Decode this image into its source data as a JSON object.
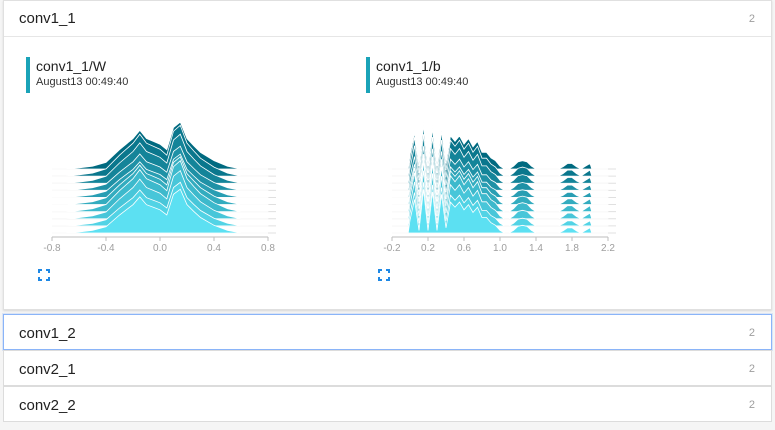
{
  "sections": [
    {
      "title": "conv1_1",
      "count": "2"
    },
    {
      "title": "conv1_2",
      "count": "2"
    },
    {
      "title": "conv2_1",
      "count": "2"
    },
    {
      "title": "conv2_2",
      "count": "2"
    }
  ],
  "cards": [
    {
      "title": "conv1_1/W",
      "subtitle": "August13 00:49:40",
      "fullscreen_icon": "fullscreen-icon"
    },
    {
      "title": "conv1_1/b",
      "subtitle": "August13 00:49:40",
      "fullscreen_icon": "fullscreen-icon"
    }
  ],
  "colors": {
    "accent": "#1aa3b8",
    "dark_teal": "#006a80",
    "light_cyan": "#5ce0f2",
    "selected_border": "#8ab4f8"
  },
  "chart_data": [
    {
      "type": "area",
      "x_ticks": [
        "-0.8",
        "-0.4",
        "0.0",
        "0.4",
        "0.8"
      ],
      "x_tick_values": [
        -0.8,
        -0.4,
        0.0,
        0.4,
        0.8
      ],
      "xlim": [
        -0.8,
        0.8
      ],
      "y_ticks": [
        "0",
        "40",
        "80"
      ],
      "y_tick_values": [
        0,
        40,
        80
      ],
      "steps": [
        0,
        10,
        20,
        30,
        40,
        50,
        60,
        70,
        80,
        90
      ],
      "x": [
        -0.8,
        -0.7,
        -0.6,
        -0.5,
        -0.4,
        -0.3,
        -0.2,
        -0.15,
        -0.1,
        -0.05,
        0.0,
        0.05,
        0.1,
        0.15,
        0.2,
        0.25,
        0.3,
        0.4,
        0.5,
        0.6,
        0.7,
        0.8
      ],
      "density": [
        0,
        0,
        0.02,
        0.05,
        0.12,
        0.35,
        0.55,
        0.7,
        0.55,
        0.5,
        0.45,
        0.35,
        0.75,
        0.85,
        0.55,
        0.42,
        0.3,
        0.15,
        0.05,
        0,
        0,
        0
      ]
    },
    {
      "type": "area",
      "x_ticks": [
        "-0.2",
        "0.2",
        "0.6",
        "1.0",
        "1.4",
        "1.8",
        "2.2"
      ],
      "x_tick_values": [
        -0.2,
        0.2,
        0.6,
        1.0,
        1.4,
        1.8,
        2.2
      ],
      "xlim": [
        -0.2,
        2.2
      ],
      "y_ticks": [
        "0",
        "40",
        "80"
      ],
      "y_tick_values": [
        0,
        40,
        80
      ],
      "steps": [
        0,
        10,
        20,
        30,
        40,
        50,
        60,
        70,
        80,
        90
      ],
      "x": [
        -0.2,
        -0.02,
        0.0,
        0.05,
        0.1,
        0.15,
        0.2,
        0.25,
        0.3,
        0.35,
        0.4,
        0.45,
        0.5,
        0.55,
        0.6,
        0.65,
        0.7,
        0.75,
        0.8,
        0.85,
        0.9,
        0.95,
        1.0,
        1.05,
        1.1,
        1.15,
        1.2,
        1.25,
        1.3,
        1.35,
        1.4,
        1.45,
        1.6,
        1.65,
        1.7,
        1.75,
        1.8,
        1.85,
        1.9,
        1.95,
        2.0,
        2.02,
        2.2
      ],
      "density": [
        0,
        0,
        0.25,
        0.65,
        0.05,
        0.85,
        0.05,
        0.8,
        0.05,
        0.75,
        0.1,
        0.6,
        0.5,
        0.6,
        0.45,
        0.55,
        0.4,
        0.5,
        0.3,
        0.3,
        0.2,
        0.15,
        0.05,
        0,
        0,
        0.05,
        0.13,
        0.15,
        0.13,
        0.05,
        0,
        0,
        0,
        0,
        0.04,
        0.1,
        0.1,
        0.04,
        0,
        0.05,
        0.1,
        0,
        0
      ]
    }
  ]
}
